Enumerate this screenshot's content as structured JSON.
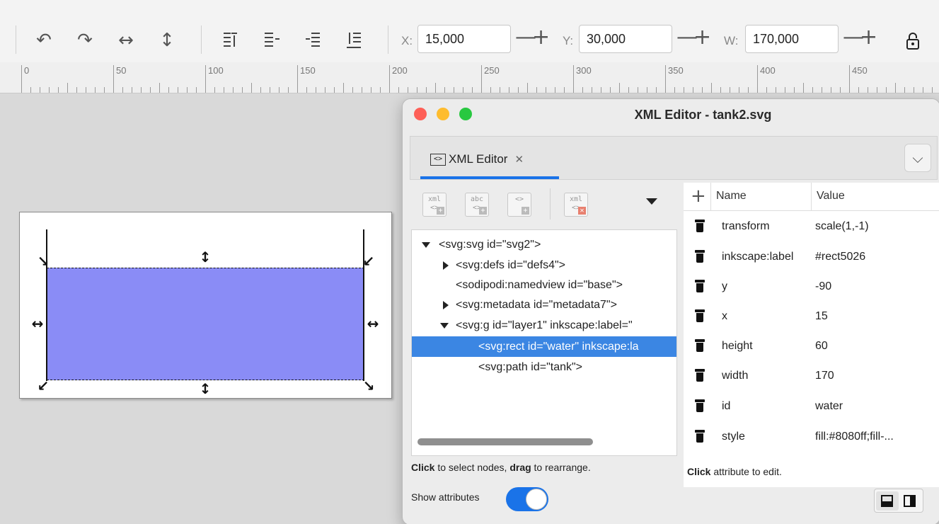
{
  "toolbar": {
    "x_label": "X:",
    "x_value": "15,000",
    "y_label": "Y:",
    "y_value": "30,000",
    "w_label": "W:",
    "w_value": "170,000",
    "stepper_minus": "—",
    "stepper_plus": "+",
    "icons": [
      "undo-icon",
      "redo-icon",
      "flip-horizontal-icon",
      "flip-vertical-icon",
      "raise-to-top-icon",
      "raise-icon",
      "lower-icon",
      "lower-to-bottom-icon",
      "lock-icon"
    ]
  },
  "ruler": {
    "labels": [
      "0",
      "50",
      "100",
      "150",
      "200",
      "250",
      "300",
      "350",
      "400",
      "450"
    ]
  },
  "canvas": {
    "water_fill": "#8a8cf6",
    "page_color": "#ffffff"
  },
  "window": {
    "title": "XML Editor - tank2.svg",
    "tab_label": "XML Editor",
    "tab_icon_text": "<>",
    "tab_close": "✕",
    "tab_menu": "⌵",
    "traffic_colors": {
      "close": "#fe5f57",
      "minimize": "#febc2e",
      "zoom": "#28c840"
    }
  },
  "node_toolbar": {
    "buttons": [
      {
        "top": "xml",
        "bottom": "<>",
        "badge": "+"
      },
      {
        "top": "abc",
        "bottom": "<>",
        "badge": "+"
      },
      {
        "top": "",
        "bottom": "<>",
        "badge": "+"
      },
      {
        "top": "xml",
        "bottom": "<>",
        "badge": "✕"
      }
    ]
  },
  "tree": {
    "nodes": [
      {
        "text": "<svg:svg id=\"svg2\">",
        "expander": "down"
      },
      {
        "text": "<svg:defs id=\"defs4\">",
        "expander": "right"
      },
      {
        "text": "<sodipodi:namedview id=\"base\">",
        "expander": "none"
      },
      {
        "text": "<svg:metadata id=\"metadata7\">",
        "expander": "right"
      },
      {
        "text": "<svg:g id=\"layer1\" inkscape:label=\"",
        "expander": "down"
      },
      {
        "text": "<svg:rect id=\"water\" inkscape:la",
        "expander": "none",
        "selected": true
      },
      {
        "text": "<svg:path id=\"tank\">",
        "expander": "none"
      }
    ],
    "hint_click": "Click",
    "hint_mid": " to select nodes, ",
    "hint_drag": "drag",
    "hint_end": " to rearrange."
  },
  "attributes": {
    "add_symbol": "+",
    "col_name": "Name",
    "col_value": "Value",
    "rows": [
      {
        "name": "transform",
        "value": "scale(1,-1)"
      },
      {
        "name": "inkscape:label",
        "value": "#rect5026"
      },
      {
        "name": "y",
        "value": "-90"
      },
      {
        "name": "x",
        "value": "15"
      },
      {
        "name": "height",
        "value": "60"
      },
      {
        "name": "width",
        "value": "170"
      },
      {
        "name": "id",
        "value": "water"
      },
      {
        "name": "style",
        "value": "fill:#8080ff;fill-..."
      }
    ],
    "hint_click": "Click",
    "hint_rest": " attribute to edit."
  },
  "bottom": {
    "show_attributes_label": "Show attributes",
    "show_attributes_on": true
  }
}
